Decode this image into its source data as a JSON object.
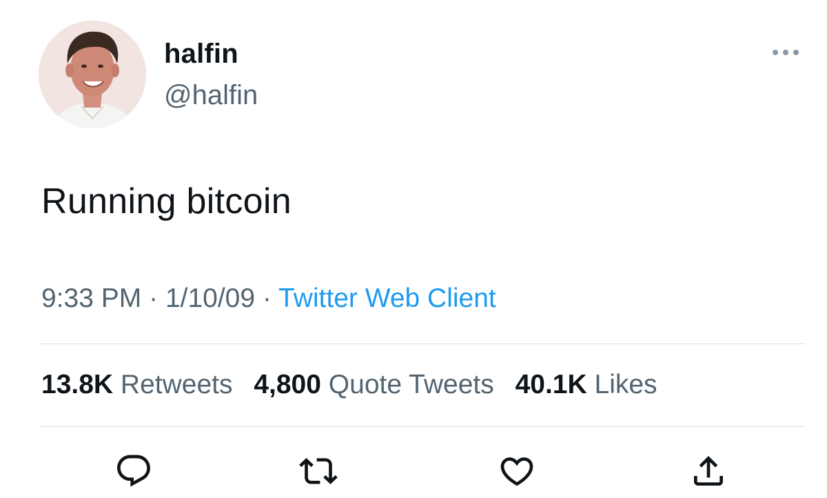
{
  "tweet": {
    "display_name": "halfin",
    "handle": "@halfin",
    "text": "Running bitcoin",
    "time": "9:33 PM",
    "separator": "·",
    "date": "1/10/09",
    "source": "Twitter Web Client"
  },
  "stats": {
    "retweets_count": "13.8K",
    "retweets_label": "Retweets",
    "quotes_count": "4,800",
    "quotes_label": "Quote Tweets",
    "likes_count": "40.1K",
    "likes_label": "Likes"
  },
  "icons": {
    "more": "more-horizontal-icon",
    "reply": "reply-icon",
    "retweet": "retweet-icon",
    "like": "heart-icon",
    "share": "share-icon"
  },
  "colors": {
    "text": "#0f1419",
    "secondary": "#536471",
    "link": "#1d9bf0",
    "divider": "#d9dde1"
  }
}
